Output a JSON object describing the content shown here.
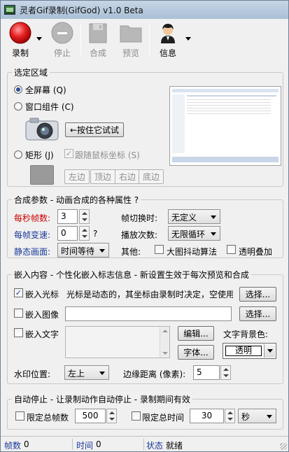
{
  "window": {
    "title": "灵者Gif录制(GifGod) v1.0 Beta"
  },
  "toolbar": {
    "record": "录制",
    "stop": "停止",
    "compose": "合成",
    "preview": "预览",
    "info": "信息"
  },
  "region": {
    "title": "选定区域",
    "fullscreen": "全屏幕 (Q)",
    "window_component": "窗口组件 (C)",
    "hold_button": "←按住它试试",
    "rect": "矩形 (J)",
    "follow_mouse": "跟随鼠标坐标 (S)",
    "left": "左边",
    "top": "顶边",
    "right": "右边",
    "bottom": "底边"
  },
  "synth": {
    "title": "合成参数 - 动画合成的各种属性  ?",
    "fps_label": "每秒帧数:",
    "fps_value": "3",
    "frame_switch_label": "帧切换时:",
    "frame_switch_value": "无定义",
    "speed_label": "每帧变速:",
    "speed_value": "0",
    "speed_help": "?",
    "play_count_label": "播放次数:",
    "play_count_value": "无限循环",
    "static_label": "静态画面:",
    "static_value": "时间等待",
    "other_label": "其他:",
    "large_dither": "大图抖动算法",
    "transparent_overlay": "透明叠加"
  },
  "embed": {
    "title": "嵌入内容 - 个性化嵌入标志信息 - 新设置生效于每次预览和合成",
    "cursor_label": "嵌入光标",
    "cursor_desc": "光标是动态的，其坐标由录制时决定，空使用",
    "select1": "选择...",
    "image_label": "嵌入图像",
    "image_path": "",
    "select2": "选择...",
    "text_label": "嵌入文字",
    "text_value": "",
    "edit": "编辑...",
    "font": "字体...",
    "bg_label": "文字背景色:",
    "bg_value": "透明",
    "watermark_label": "水印位置:",
    "watermark_value": "左上",
    "margin_label": "边缘距离 (像素):",
    "margin_value": "5"
  },
  "autostop": {
    "title": "自动停止 - 让录制动作自动停止 - 录制期间有效",
    "frames_label": "限定总帧数",
    "frames_value": "500",
    "time_label": "限定总时间",
    "time_value": "30",
    "unit_value": "秒"
  },
  "status": {
    "frames_label": "帧数",
    "frames_value": "0",
    "time_label": "时间",
    "time_value": "0",
    "state_label": "状态",
    "state_value": "就绪"
  },
  "colors": {
    "red_label": "#cc0000",
    "blue_label": "#1a3a99"
  }
}
